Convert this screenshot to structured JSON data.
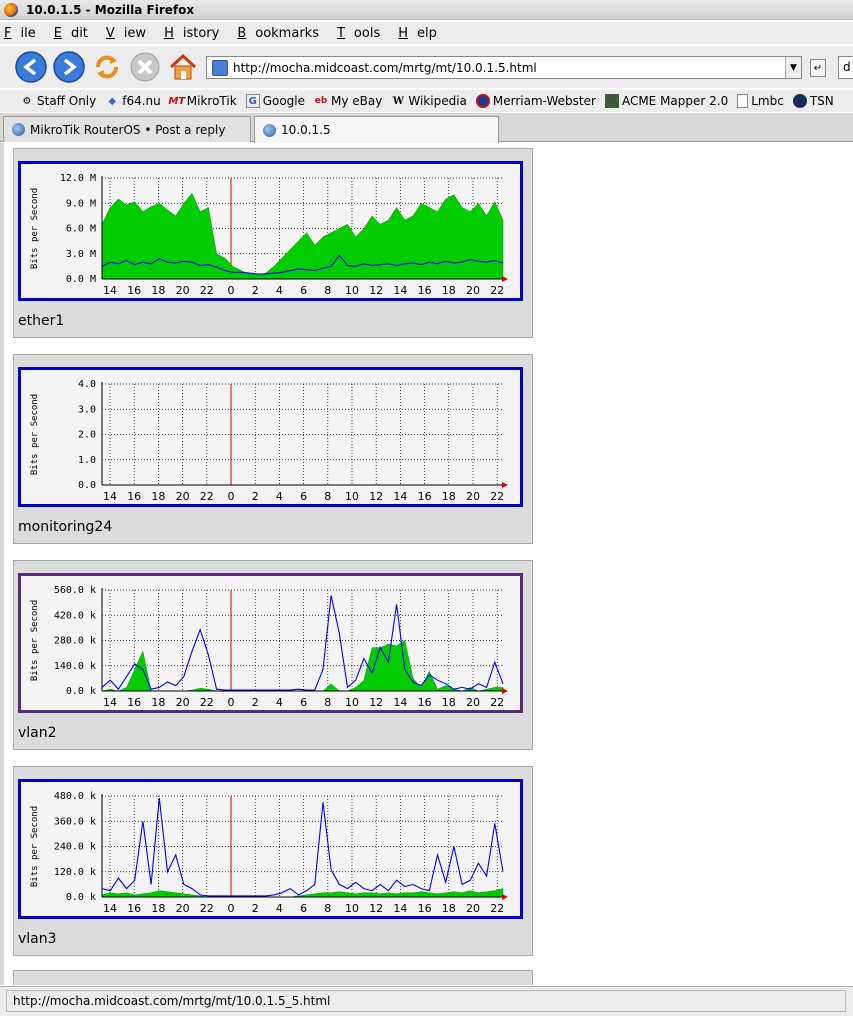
{
  "window": {
    "title": "10.0.1.5 - Mozilla Firefox"
  },
  "menu": {
    "items": [
      {
        "u": "F",
        "rest": "ile"
      },
      {
        "u": "E",
        "rest": "dit"
      },
      {
        "u": "V",
        "rest": "iew"
      },
      {
        "u": "H",
        "rest": "istory"
      },
      {
        "u": "B",
        "rest": "ookmarks"
      },
      {
        "u": "T",
        "rest": "ools"
      },
      {
        "u": "H",
        "rest": "elp"
      }
    ]
  },
  "nav": {
    "url": "http://mocha.midcoast.com/mrtg/mt/10.0.1.5.html",
    "search_value": "d"
  },
  "bookmarks": {
    "items": [
      {
        "label": "Staff Only",
        "icon": "gear-icon"
      },
      {
        "label": "f64.nu",
        "icon": "bookmark-icon"
      },
      {
        "label": "MikroTik",
        "icon": "mt-icon",
        "icon_text": "MT"
      },
      {
        "label": "Google",
        "icon": "google-icon",
        "icon_text": "G"
      },
      {
        "label": "My eBay",
        "icon": "ebay-icon",
        "icon_text": "eb"
      },
      {
        "label": "Wikipedia",
        "icon": "wikipedia-icon",
        "icon_text": "W"
      },
      {
        "label": "Merriam-Webster",
        "icon": "mw-icon"
      },
      {
        "label": "ACME Mapper 2.0",
        "icon": "acme-icon"
      },
      {
        "label": "Lmbc",
        "icon": "page-icon"
      },
      {
        "label": "TSN",
        "icon": "tsn-icon"
      }
    ]
  },
  "tabs": [
    {
      "label": "MikroTik RouterOS • Post a reply",
      "active": false
    },
    {
      "label": "10.0.1.5",
      "active": true
    }
  ],
  "chart_data": [
    {
      "type": "area",
      "name": "ether1",
      "ylabel": "Bits per Second",
      "yticks": [
        "12.0 M",
        "9.0 M",
        "6.0 M",
        "3.0 M",
        "0.0 M"
      ],
      "ylim": [
        0,
        12
      ],
      "xticks": [
        "14",
        "16",
        "18",
        "20",
        "22",
        "0",
        "2",
        "4",
        "6",
        "8",
        "10",
        "12",
        "14",
        "16",
        "18",
        "20",
        "22"
      ],
      "grid": true,
      "series": [
        {
          "color": "#00cc00",
          "kind": "area",
          "values": [
            6.5,
            8.5,
            9.5,
            8.8,
            9.2,
            8.0,
            8.6,
            9.0,
            8.2,
            7.5,
            9.0,
            10.2,
            8.0,
            8.5,
            3.0,
            2.5,
            1.5,
            1.0,
            0.6,
            0.5,
            0.7,
            1.5,
            2.5,
            3.5,
            4.5,
            5.5,
            4.0,
            5.0,
            5.5,
            6.0,
            6.5,
            5.0,
            6.0,
            7.5,
            6.5,
            7.0,
            8.5,
            7.0,
            7.5,
            9.0,
            8.5,
            8.0,
            9.5,
            10.0,
            8.5,
            8.0,
            9.0,
            7.5,
            9.2,
            7.0
          ]
        },
        {
          "color": "#0000ff",
          "kind": "line",
          "values": [
            1.5,
            2.0,
            1.8,
            2.2,
            1.7,
            2.0,
            1.8,
            2.4,
            2.0,
            1.9,
            2.1,
            2.0,
            1.6,
            1.7,
            1.4,
            1.0,
            0.8,
            0.8,
            0.7,
            0.6,
            0.6,
            0.7,
            0.8,
            1.0,
            1.2,
            1.1,
            1.0,
            1.3,
            1.5,
            2.8,
            1.6,
            1.5,
            1.8,
            1.6,
            1.7,
            1.8,
            1.6,
            1.8,
            1.9,
            1.7,
            2.0,
            1.8,
            2.1,
            1.9,
            2.0,
            2.3,
            2.1,
            2.0,
            2.2,
            1.9
          ]
        }
      ]
    },
    {
      "type": "area",
      "name": "monitoring24",
      "ylabel": "Bits per Second",
      "yticks": [
        "4.0",
        "3.0",
        "2.0",
        "1.0",
        "0.0"
      ],
      "ylim": [
        0,
        4
      ],
      "xticks": [
        "14",
        "16",
        "18",
        "20",
        "22",
        "0",
        "2",
        "4",
        "6",
        "8",
        "10",
        "12",
        "14",
        "16",
        "18",
        "20",
        "22"
      ],
      "grid": true,
      "series": []
    },
    {
      "type": "area",
      "name": "vlan2",
      "ylabel": "Bits per Second",
      "yticks": [
        "560.0 k",
        "420.0 k",
        "280.0 k",
        "140.0 k",
        "0.0 k"
      ],
      "ylim": [
        0,
        560
      ],
      "xticks": [
        "14",
        "16",
        "18",
        "20",
        "22",
        "0",
        "2",
        "4",
        "6",
        "8",
        "10",
        "12",
        "14",
        "16",
        "18",
        "20",
        "22"
      ],
      "grid": true,
      "series": [
        {
          "color": "#00cc00",
          "kind": "area",
          "values": [
            0,
            10,
            0,
            20,
            120,
            220,
            0,
            0,
            0,
            0,
            0,
            5,
            15,
            10,
            0,
            0,
            0,
            0,
            0,
            0,
            0,
            0,
            0,
            0,
            0,
            0,
            0,
            0,
            40,
            0,
            0,
            20,
            60,
            240,
            240,
            260,
            250,
            280,
            70,
            20,
            110,
            10,
            30,
            10,
            0,
            20,
            0,
            10,
            20,
            20
          ]
        },
        {
          "color": "#0000ff",
          "kind": "line",
          "values": [
            20,
            60,
            10,
            80,
            150,
            120,
            10,
            20,
            50,
            30,
            80,
            220,
            340,
            200,
            10,
            5,
            5,
            5,
            5,
            5,
            5,
            5,
            5,
            5,
            10,
            5,
            5,
            120,
            530,
            320,
            20,
            60,
            180,
            100,
            240,
            160,
            480,
            120,
            50,
            30,
            90,
            60,
            40,
            10,
            20,
            10,
            40,
            20,
            160,
            40
          ]
        }
      ]
    },
    {
      "type": "area",
      "name": "vlan3",
      "ylabel": "Bits per Second",
      "yticks": [
        "480.0 k",
        "360.0 k",
        "240.0 k",
        "120.0 k",
        "0.0 k"
      ],
      "ylim": [
        0,
        480
      ],
      "xticks": [
        "14",
        "16",
        "18",
        "20",
        "22",
        "0",
        "2",
        "4",
        "6",
        "8",
        "10",
        "12",
        "14",
        "16",
        "18",
        "20",
        "22"
      ],
      "grid": true,
      "series": [
        {
          "color": "#00cc00",
          "kind": "area",
          "values": [
            10,
            20,
            15,
            20,
            10,
            15,
            20,
            30,
            25,
            20,
            15,
            10,
            5,
            0,
            0,
            0,
            0,
            0,
            0,
            0,
            0,
            0,
            0,
            0,
            5,
            10,
            15,
            20,
            20,
            25,
            20,
            15,
            20,
            20,
            15,
            20,
            15,
            20,
            20,
            25,
            20,
            15,
            20,
            25,
            20,
            30,
            20,
            25,
            30,
            40
          ]
        },
        {
          "color": "#0000ff",
          "kind": "line",
          "values": [
            40,
            30,
            90,
            40,
            80,
            360,
            60,
            470,
            120,
            200,
            60,
            40,
            10,
            5,
            5,
            5,
            5,
            5,
            5,
            5,
            5,
            10,
            20,
            40,
            10,
            30,
            60,
            450,
            130,
            60,
            40,
            70,
            40,
            30,
            60,
            30,
            80,
            50,
            60,
            40,
            30,
            200,
            70,
            240,
            60,
            80,
            160,
            100,
            350,
            120
          ]
        }
      ]
    }
  ],
  "status": {
    "text": "http://mocha.midcoast.com/mrtg/mt/10.0.1.5_5.html"
  }
}
